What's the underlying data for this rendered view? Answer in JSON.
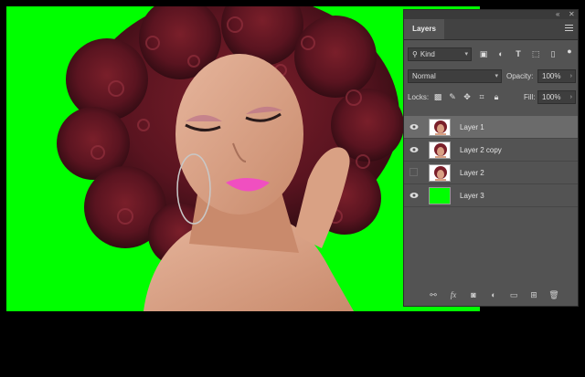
{
  "panel": {
    "tab_label": "Layers",
    "filter": {
      "value": "Kind"
    },
    "blend_mode": {
      "value": "Normal"
    },
    "opacity": {
      "label": "Opacity:",
      "value": "100%"
    },
    "fill": {
      "label": "Fill:",
      "value": "100%"
    },
    "locks_label": "Locks:",
    "layers": [
      {
        "name": "Layer 1",
        "visible": true,
        "selected": true,
        "thumb": "portrait"
      },
      {
        "name": "Layer 2 copy",
        "visible": true,
        "selected": false,
        "thumb": "portrait"
      },
      {
        "name": "Layer 2",
        "visible": false,
        "selected": false,
        "thumb": "portrait"
      },
      {
        "name": "Layer 3",
        "visible": true,
        "selected": false,
        "thumb": "green"
      }
    ]
  },
  "canvas": {
    "background_color": "#00ff00"
  }
}
